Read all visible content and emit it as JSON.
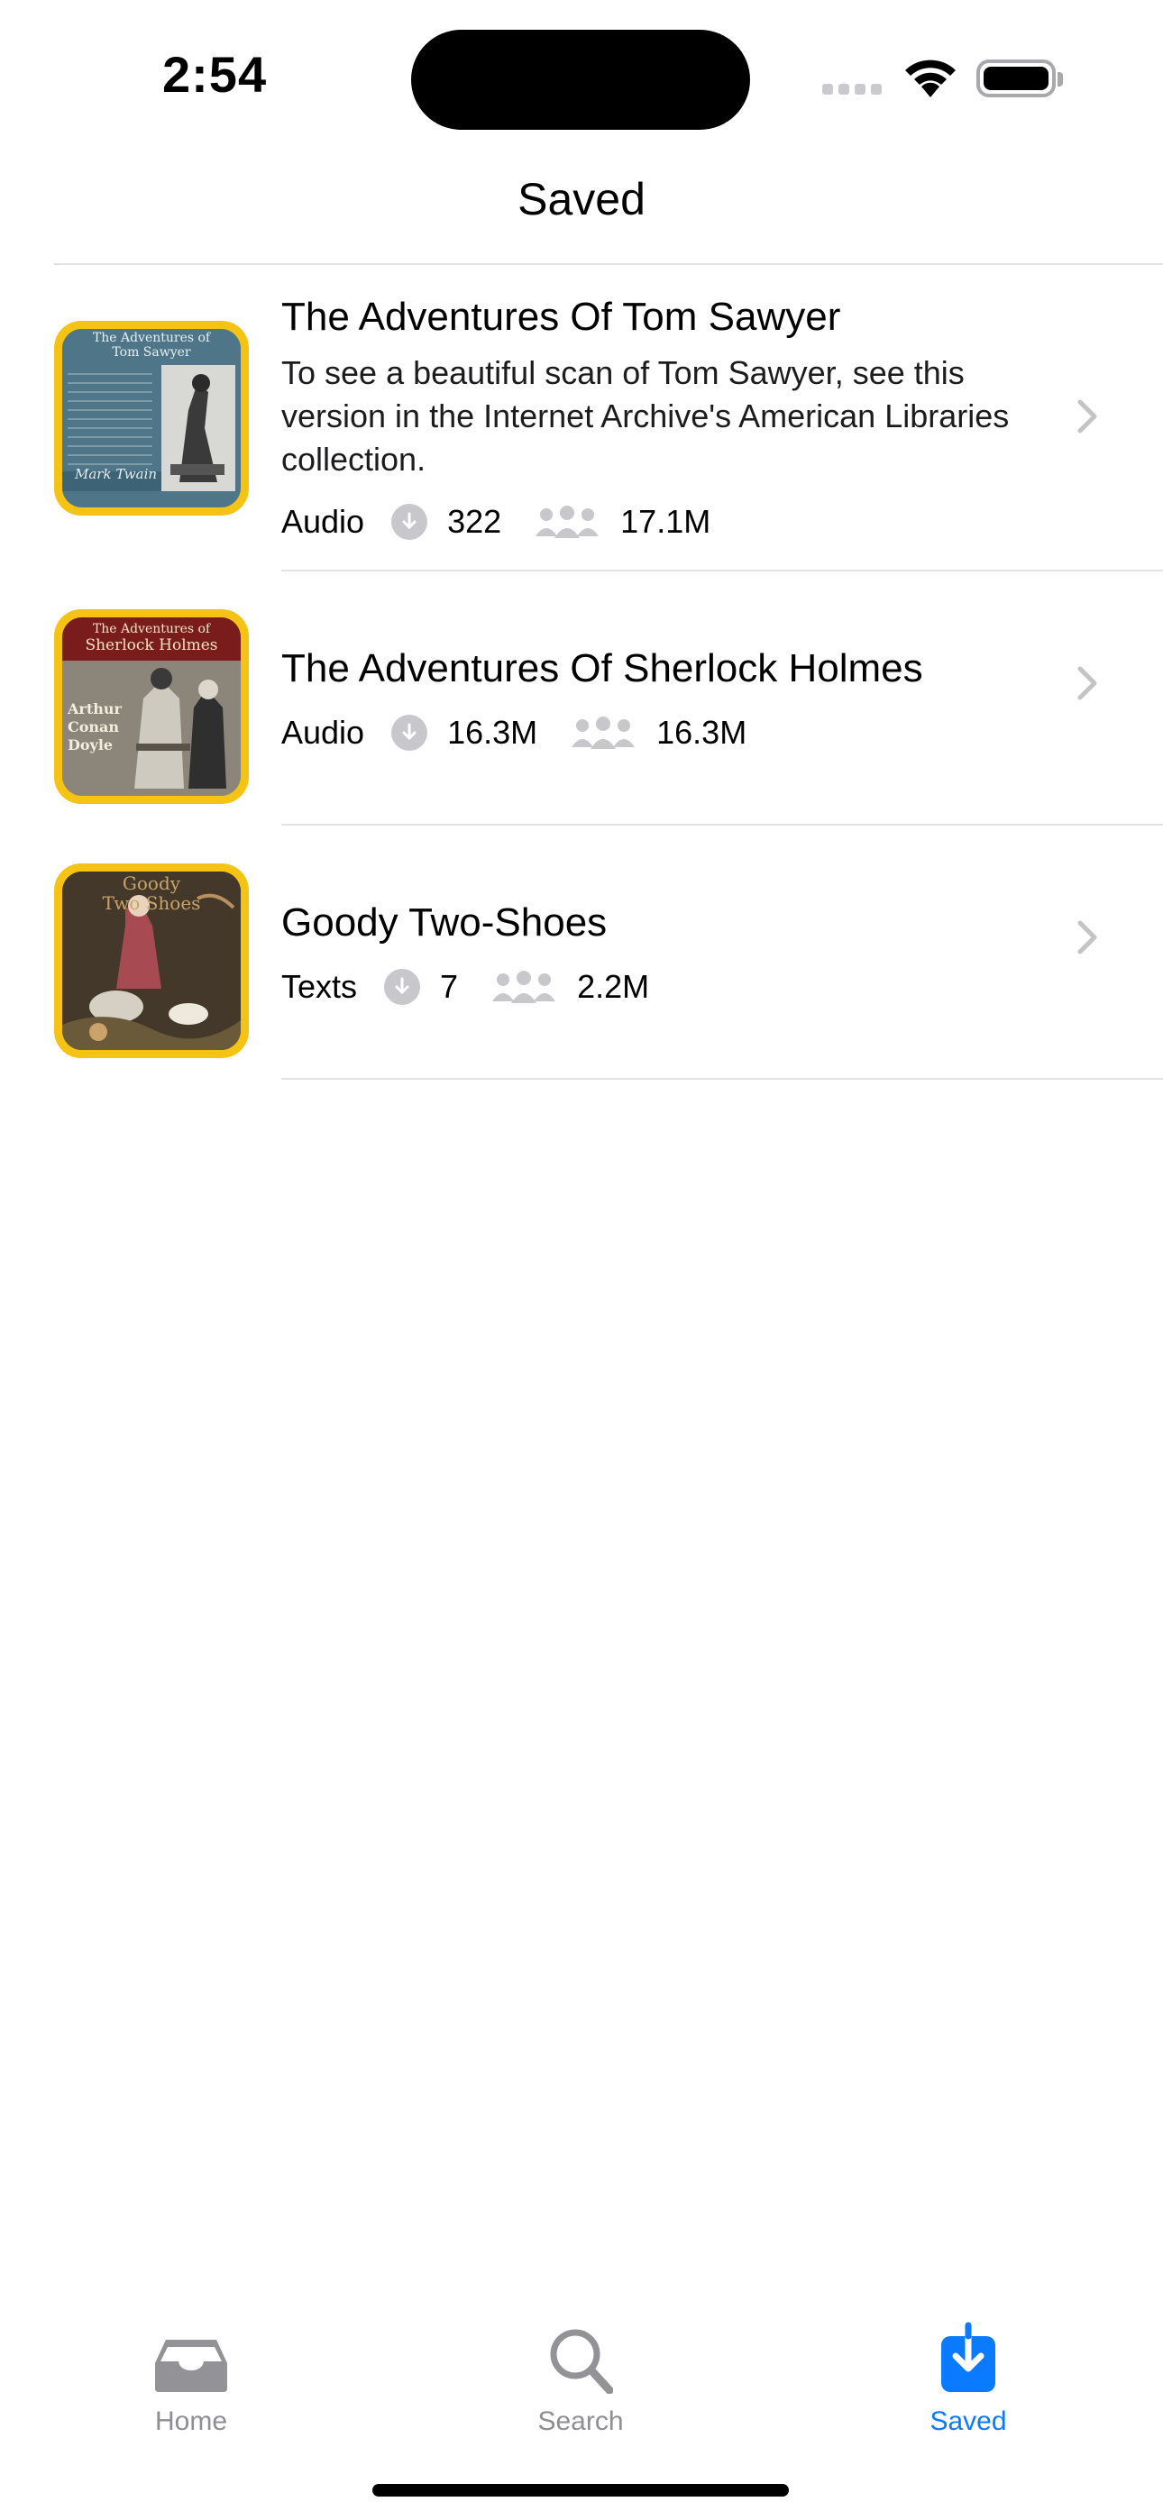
{
  "status_bar": {
    "time": "2:54"
  },
  "nav": {
    "title": "Saved"
  },
  "items": [
    {
      "title": "The Adventures Of Tom Sawyer",
      "description": "To see a beautiful scan of Tom Sawyer, see this version in the Internet Archive's American Libraries collection.",
      "type": "Audio",
      "downloads": "322",
      "views": "17.1M",
      "cover": {
        "line1": "The Adventures of",
        "line2": "Tom Sawyer",
        "author": "Mark Twain",
        "bg": "#4e7486"
      }
    },
    {
      "title": "The Adventures Of Sherlock Holmes",
      "description": "",
      "type": "Audio",
      "downloads": "16.3M",
      "views": "16.3M",
      "cover": {
        "line1": "The Adventures of",
        "line2": "Sherlock Holmes",
        "author1": "Arthur",
        "author2": "Conan",
        "author3": "Doyle",
        "bg": "#7a1c1c"
      }
    },
    {
      "title": "Goody Two-Shoes",
      "description": "",
      "type": "Texts",
      "downloads": "7",
      "views": "2.2M",
      "cover": {
        "line1": "Goody",
        "line2": "Two Shoes",
        "bg": "#3f3324"
      }
    }
  ],
  "tabs": [
    {
      "label": "Home",
      "icon": "tray-icon",
      "active": false
    },
    {
      "label": "Search",
      "icon": "magnifier-icon",
      "active": false
    },
    {
      "label": "Saved",
      "icon": "download-square-icon",
      "active": true
    }
  ],
  "colors": {
    "accent": "#0a7aff",
    "thumb_border": "#f5c313",
    "inactive": "#8e8e93"
  }
}
